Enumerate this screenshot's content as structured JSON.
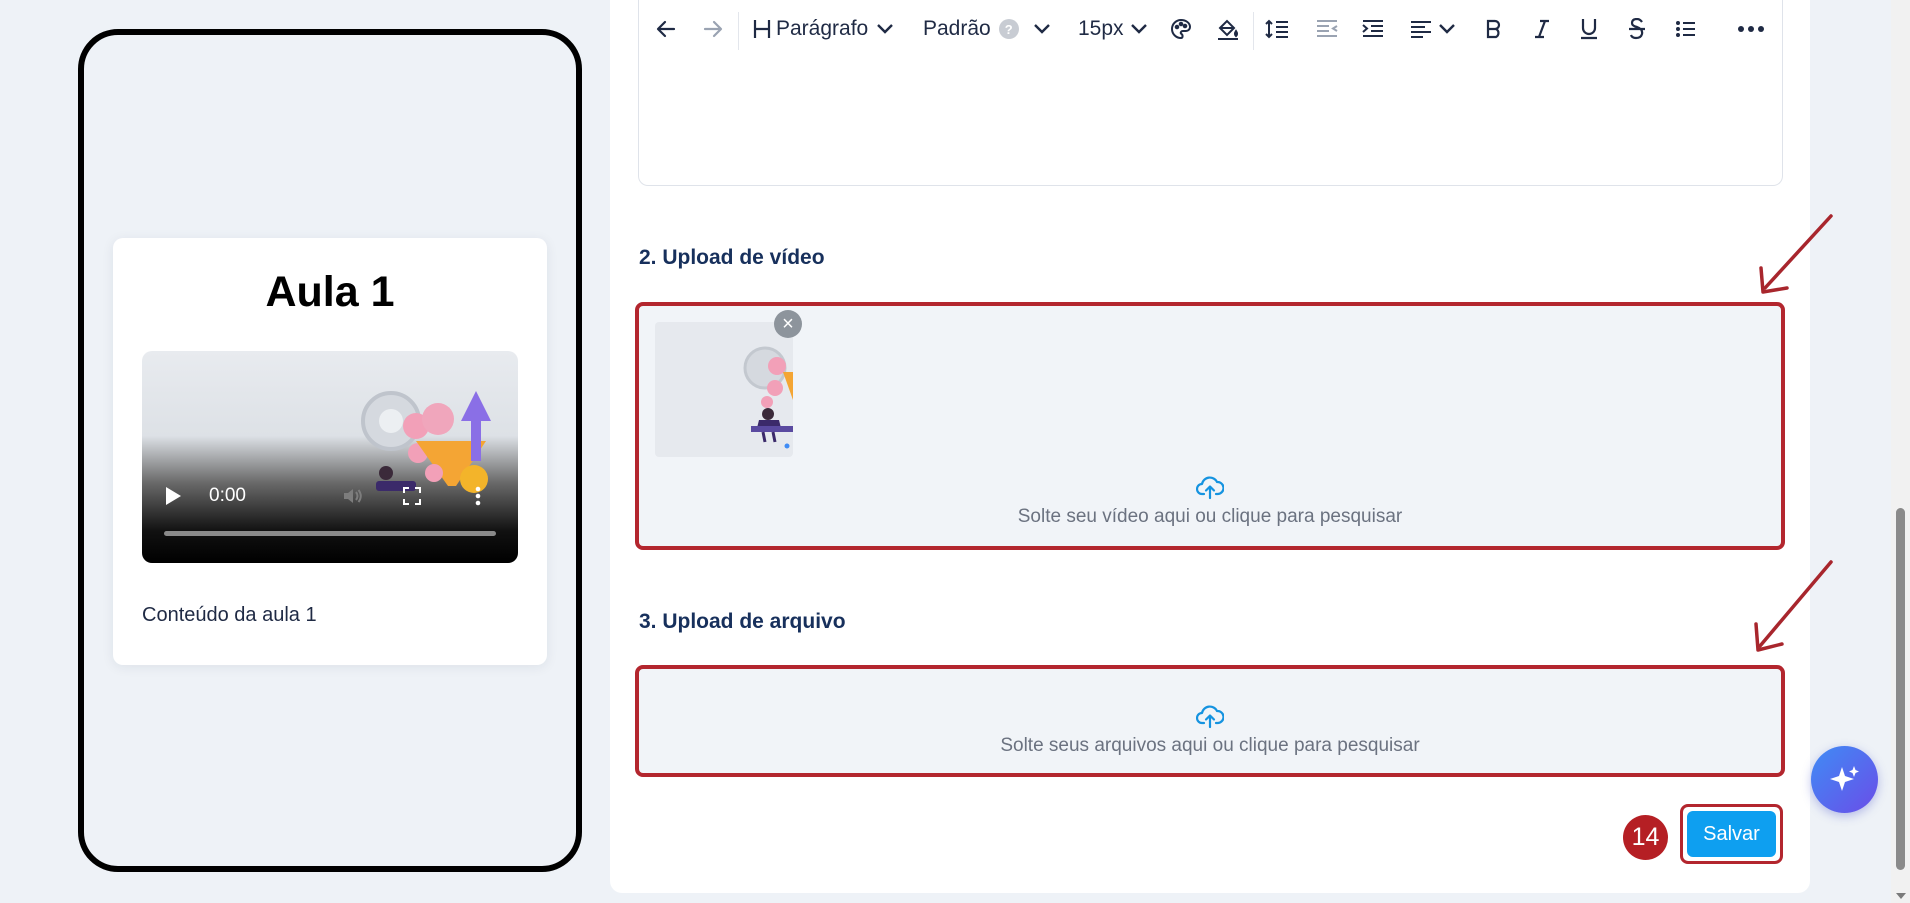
{
  "preview": {
    "lesson_title": "Aula 1",
    "video": {
      "time": "0:00",
      "progress": 0
    },
    "lesson_content": "Conteúdo da aula 1"
  },
  "toolbar": {
    "heading_label": "Parágrafo",
    "style_label": "Padrão",
    "style_help": "?",
    "font_size": "15px"
  },
  "sections": {
    "video_upload": {
      "title": "2. Upload de vídeo",
      "drop_text": "Solte seu vídeo aqui ou clique para pesquisar",
      "remove_symbol": "×"
    },
    "file_upload": {
      "title": "3. Upload de arquivo",
      "drop_text": "Solte seus arquivos aqui ou clique para pesquisar"
    }
  },
  "actions": {
    "save_label": "Salvar",
    "step_badge": "14"
  },
  "colors": {
    "accent": "#0e9ff0",
    "highlight": "#b3262e",
    "heading": "#17305c",
    "badge": "#b51f24"
  }
}
